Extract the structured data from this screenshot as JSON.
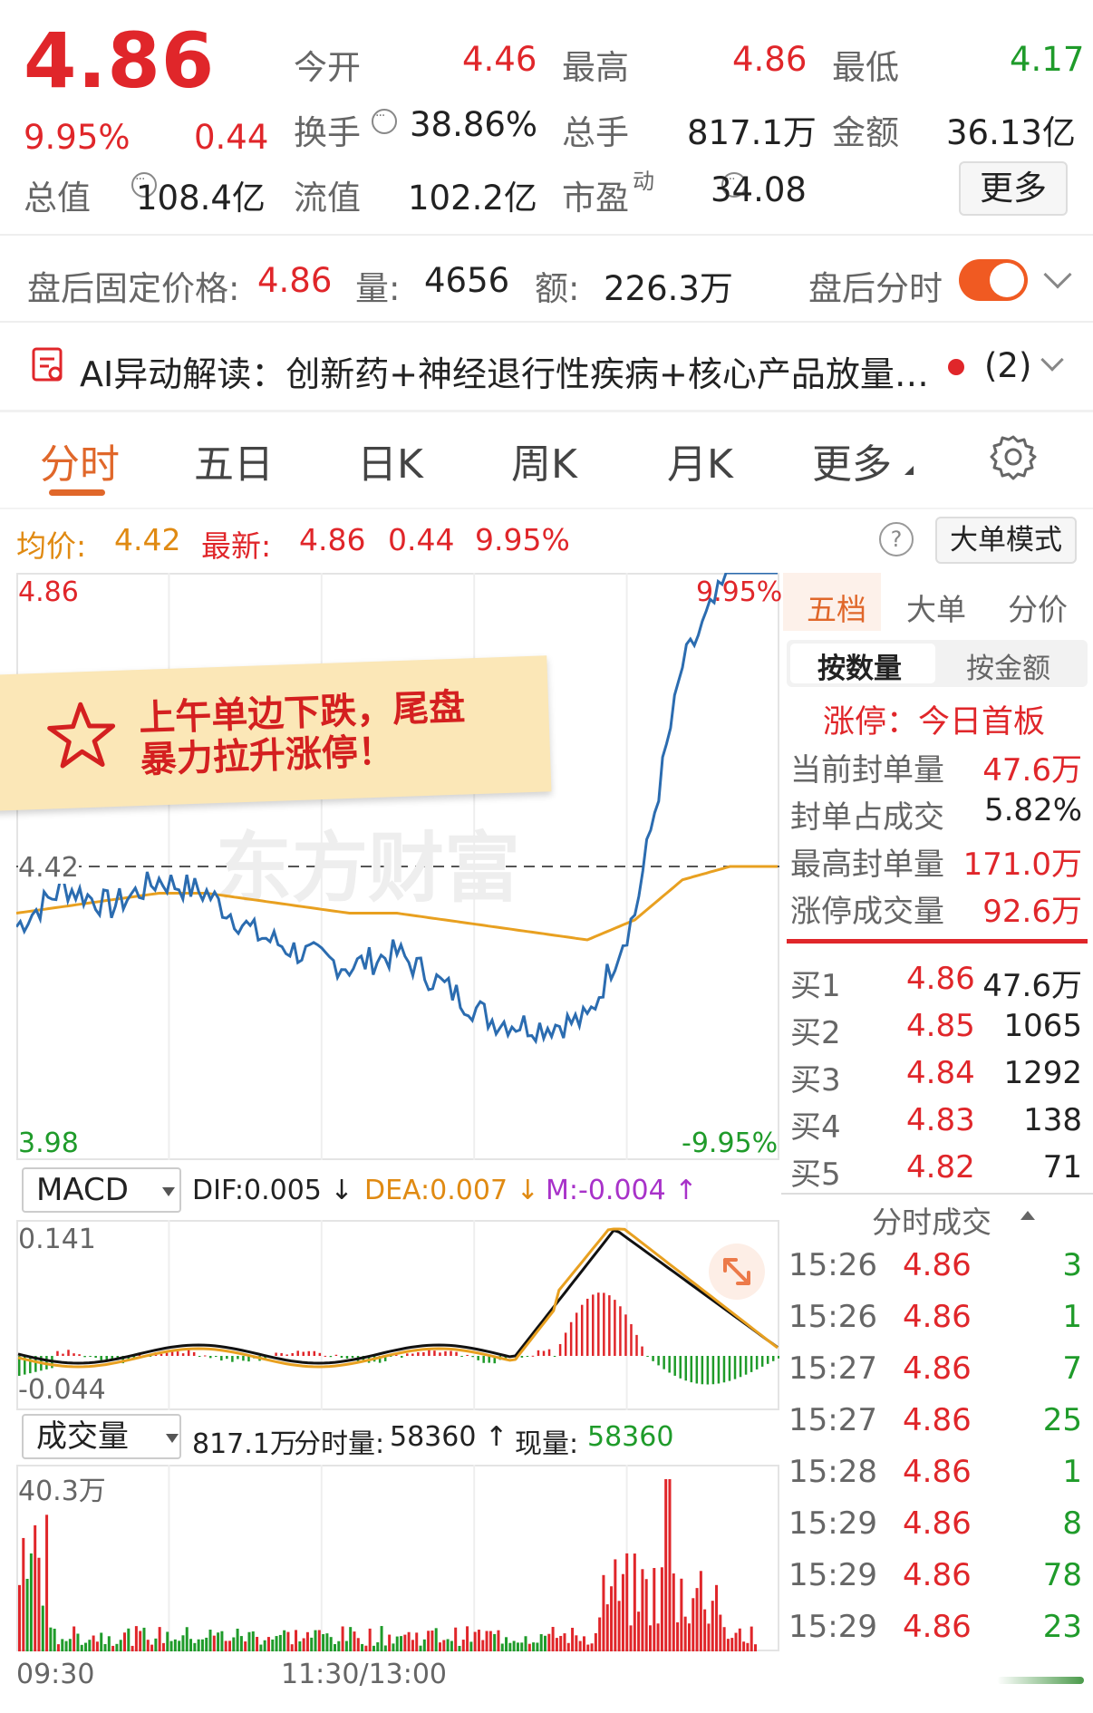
{
  "quote": {
    "price": "4.86",
    "change_pct": "9.95%",
    "change": "0.44",
    "stats": [
      {
        "label": "今开",
        "value": "4.46",
        "color": "red"
      },
      {
        "label": "最高",
        "value": "4.86",
        "color": "red"
      },
      {
        "label": "最低",
        "value": "4.17",
        "color": "green"
      },
      {
        "label": "换手",
        "value": "38.86%",
        "color": "dark"
      },
      {
        "label": "总手",
        "value": "817.1万",
        "color": "dark"
      },
      {
        "label": "金额",
        "value": "36.13亿",
        "color": "dark"
      },
      {
        "label": "总值",
        "value": "108.4亿",
        "color": "dark"
      },
      {
        "label": "流值",
        "value": "102.2亿",
        "color": "dark"
      },
      {
        "label": "市盈",
        "value": "34.08",
        "color": "dark"
      }
    ],
    "pe_sup": "动",
    "more_button": "更多"
  },
  "after_hours": {
    "price_label": "盘后固定价格:",
    "price": "4.86",
    "vol_label": "量:",
    "vol": "4656",
    "amt_label": "额:",
    "amt": "226.3万",
    "toggle_label": "盘后分时",
    "toggle_on": true
  },
  "ai_banner": {
    "text": "AI异动解读：创新药+神经退行性疾病+核心产品放量…",
    "count": "(2)"
  },
  "tabs": [
    "分时",
    "五日",
    "日K",
    "周K",
    "月K",
    "更多"
  ],
  "active_tab": "分时",
  "info_line": {
    "avg_label": "均价:",
    "avg": "4.42",
    "latest_label": "最新:",
    "latest": "4.86",
    "change": "0.44",
    "pct": "9.95%",
    "mode_button": "大单模式"
  },
  "sticker": {
    "line1": "上午单边下跌，尾盘",
    "line2": "暴力拉升涨停！"
  },
  "watermark": "东方财富",
  "orderbook": {
    "tabs": [
      "五档",
      "大单",
      "分价"
    ],
    "active_tab": "五档",
    "subtabs": [
      "按数量",
      "按金额"
    ],
    "active_subtab": "按数量",
    "limit_up_text": "涨停：今日首板",
    "metrics": [
      {
        "label": "当前封单量",
        "value": "47.6万",
        "color": "red"
      },
      {
        "label": "封单占成交",
        "value": "5.82%",
        "color": "dark"
      },
      {
        "label": "最高封单量",
        "value": "171.0万",
        "color": "red"
      },
      {
        "label": "涨停成交量",
        "value": "92.6万",
        "color": "red"
      }
    ],
    "bids": [
      {
        "label": "买1",
        "price": "4.86",
        "vol": "47.6万"
      },
      {
        "label": "买2",
        "price": "4.85",
        "vol": "1065"
      },
      {
        "label": "买3",
        "price": "4.84",
        "vol": "1292"
      },
      {
        "label": "买4",
        "price": "4.83",
        "vol": "138"
      },
      {
        "label": "买5",
        "price": "4.82",
        "vol": "71"
      }
    ],
    "trades_title": "分时成交",
    "trades": [
      {
        "time": "15:26",
        "price": "4.86",
        "vol": "3"
      },
      {
        "time": "15:26",
        "price": "4.86",
        "vol": "1"
      },
      {
        "time": "15:27",
        "price": "4.86",
        "vol": "7"
      },
      {
        "time": "15:27",
        "price": "4.86",
        "vol": "25"
      },
      {
        "time": "15:28",
        "price": "4.86",
        "vol": "1"
      },
      {
        "time": "15:29",
        "price": "4.86",
        "vol": "8"
      },
      {
        "time": "15:29",
        "price": "4.86",
        "vol": "78"
      },
      {
        "time": "15:29",
        "price": "4.86",
        "vol": "23"
      }
    ]
  },
  "macd": {
    "selector": "MACD",
    "dif": "DIF:0.005 ↓",
    "dea": "DEA:0.007 ↓",
    "m": "M:-0.004 ↑",
    "ymax_label": "0.141",
    "ymin_label": "-0.044"
  },
  "volume": {
    "selector": "成交量",
    "total": "817.1万",
    "seg_label": "分时量:",
    "seg": "58360 ↑",
    "now_label": "现量:",
    "now": "58360",
    "ymax_label": "40.3万",
    "x_labels": [
      "09:30",
      "11:30/13:00"
    ]
  },
  "chart_data": {
    "type": "line",
    "x": [
      "09:30",
      "09:45",
      "10:00",
      "10:15",
      "10:30",
      "10:45",
      "11:00",
      "11:15",
      "11:30",
      "13:15",
      "13:30",
      "13:45",
      "14:00",
      "14:15",
      "14:30",
      "14:45",
      "15:00"
    ],
    "ylim": [
      3.98,
      4.86
    ],
    "y_ticks": [
      "4.86",
      "4.42",
      "3.98"
    ],
    "pct_ticks": [
      "9.95%",
      "-9.95%"
    ],
    "prev_close": 4.42,
    "series": [
      {
        "name": "最新",
        "color": "#2b6cb0",
        "values": [
          4.33,
          4.39,
          4.36,
          4.4,
          4.38,
          4.32,
          4.29,
          4.27,
          4.29,
          4.24,
          4.19,
          4.18,
          4.19,
          4.35,
          4.72,
          4.86,
          4.86
        ]
      },
      {
        "name": "均价",
        "color": "#e8a020",
        "values": [
          4.35,
          4.36,
          4.37,
          4.38,
          4.38,
          4.37,
          4.36,
          4.35,
          4.35,
          4.34,
          4.33,
          4.32,
          4.31,
          4.34,
          4.4,
          4.42,
          4.42
        ]
      }
    ]
  }
}
